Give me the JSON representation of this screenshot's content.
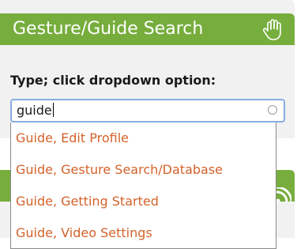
{
  "colors": {
    "panel_header": "#76ad3c",
    "panel_bg": "#f1f1f1",
    "option_text": "#d4622a",
    "input_focus_border": "#86aee0"
  },
  "search_panel": {
    "title": "Gesture/Guide Search",
    "header_icon": "hand-pointer-icon",
    "instruction": "Type; click dropdown option:",
    "search": {
      "value": "guide",
      "clear_icon": "clear-circle-icon"
    }
  },
  "lower_panel": {
    "header_icon": "rss-icon"
  },
  "dropdown": {
    "options": [
      {
        "label": "Guide, Edit Profile"
      },
      {
        "label": "Guide, Gesture Search/Database"
      },
      {
        "label": "Guide, Getting Started"
      },
      {
        "label": "Guide, Video Settings"
      }
    ]
  }
}
